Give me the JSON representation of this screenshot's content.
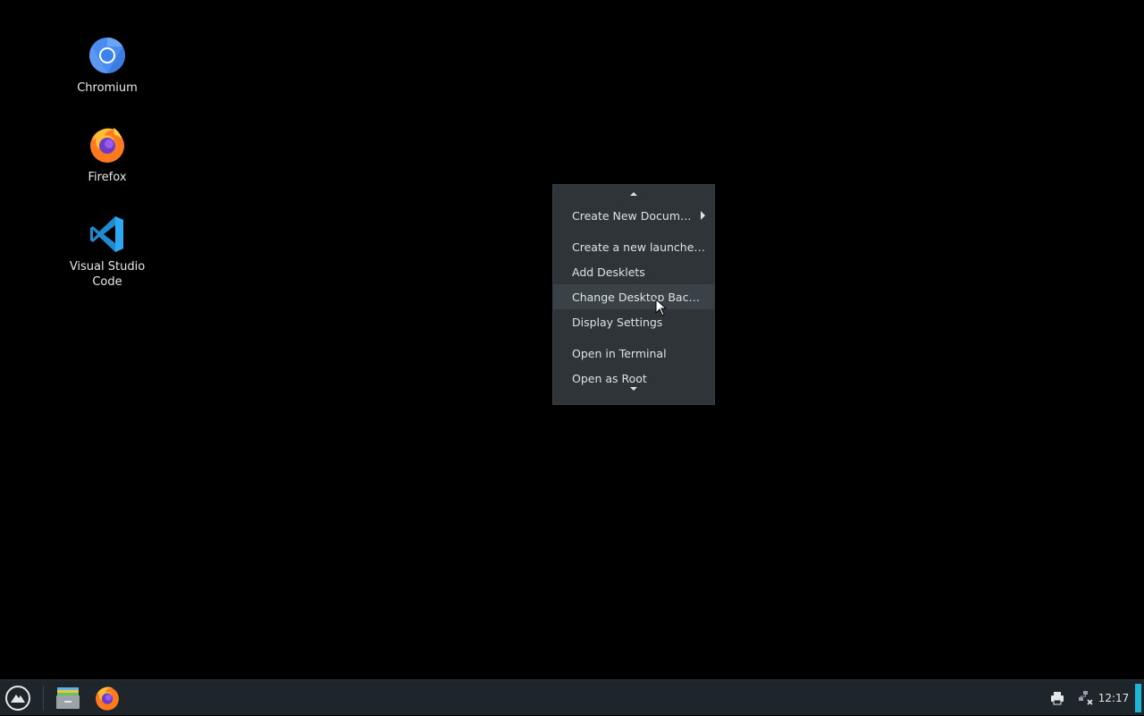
{
  "desktop": {
    "icons": [
      {
        "label": "Chromium",
        "icon": "chromium-icon"
      },
      {
        "label": "Firefox",
        "icon": "firefox-icon"
      },
      {
        "label": "Visual Studio Code",
        "icon": "vscode-icon"
      }
    ]
  },
  "context_menu": {
    "items": [
      {
        "label": "Create New Document",
        "has_submenu": true
      },
      {
        "label": "Create a new launcher here...",
        "has_submenu": false
      },
      {
        "label": "Add Desklets",
        "has_submenu": false
      },
      {
        "label": "Change Desktop Background...",
        "has_submenu": false,
        "hovered": true
      },
      {
        "label": "Display Settings",
        "has_submenu": false
      },
      {
        "label": "Open in Terminal",
        "has_submenu": false
      },
      {
        "label": "Open as Root",
        "has_submenu": false
      }
    ]
  },
  "taskbar": {
    "menu_button": "menu-icon",
    "launchers": [
      "files-icon",
      "firefox-icon"
    ],
    "tray": [
      "printer-icon",
      "network-disconnected-icon"
    ],
    "clock": "12:17"
  },
  "colors": {
    "desktop_bg": "#000000",
    "menu_bg": "#2e3438",
    "menu_hover": "#3b4247",
    "taskbar_bg": "#1f262b",
    "accent": "#1fb6d6"
  }
}
